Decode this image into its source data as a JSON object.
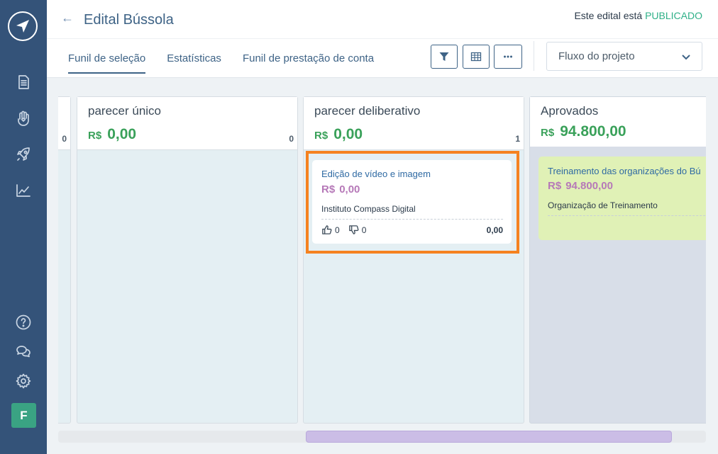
{
  "header": {
    "title": "Edital Bússola",
    "status_prefix": "Este edital está",
    "status_value": "PUBLICADO",
    "tabs": [
      {
        "label": "Funil de seleção",
        "active": true
      },
      {
        "label": "Estatísticas",
        "active": false
      },
      {
        "label": "Funil de prestação de conta",
        "active": false
      }
    ],
    "flow_select": {
      "value": "Fluxo do projeto"
    }
  },
  "sidebar": {
    "items": [
      "document-icon",
      "hand-heart-icon",
      "rocket-icon",
      "chart-icon"
    ],
    "bottom": [
      "help-icon",
      "chat-icon",
      "settings-icon"
    ],
    "avatar_letter": "F"
  },
  "columns": [
    {
      "title": "",
      "currency": "",
      "total": "",
      "count": "0"
    },
    {
      "title": "parecer único",
      "currency": "R$",
      "total": "0,00",
      "count": "0"
    },
    {
      "title": "parecer deliberativo",
      "currency": "R$",
      "total": "0,00",
      "count": "1"
    },
    {
      "title": "Aprovados",
      "currency": "R$",
      "total": "94.800,00",
      "count": ""
    }
  ],
  "cards": [
    {
      "title": "Edição de vídeo e imagem",
      "currency": "R$",
      "value": "0,00",
      "org": "Instituto Compass Digital",
      "likes": "0",
      "dislikes": "0",
      "amount": "0,00"
    },
    {
      "title": "Treinamento das organizações do Bú",
      "currency": "R$",
      "value": "94.800,00",
      "org": "Organização de Treinamento"
    }
  ],
  "colors": {
    "sidebar": "#345379",
    "accent": "#3e6386",
    "published": "#2fb088",
    "total_green": "#3aa15a",
    "card_value": "#b679b8",
    "highlight": "#f58220",
    "approved_bg": "#d8dee8",
    "approved_card": "#e0f1b6"
  }
}
